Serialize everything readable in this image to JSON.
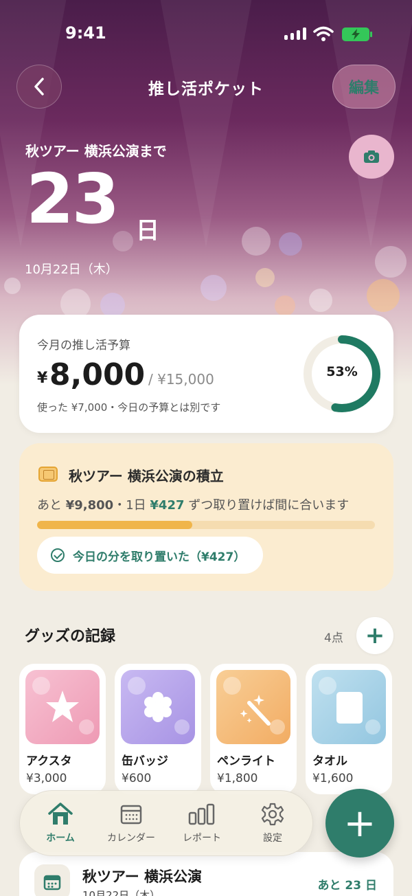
{
  "status_bar": {
    "time": "9:41"
  },
  "header": {
    "title": "推し活ポケット",
    "edit_label": "編集"
  },
  "countdown": {
    "label": "秋ツアー 横浜公演まで",
    "days": "23",
    "unit": "日",
    "date": "10月22日（木）"
  },
  "budget": {
    "title": "今月の推し活予算",
    "currency": "¥",
    "remaining": "8,000",
    "total": "/ ¥15,000",
    "note": "使った ¥7,000・今日の予算とは別です",
    "percent_label": "53%",
    "percent": 53,
    "ring_color": "#1f7a62"
  },
  "savings": {
    "title": "秋ツアー 横浜公演の積立",
    "text_prefix": "あと ",
    "remaining": "¥9,800",
    "text_mid": "・1日 ",
    "daily": "¥427",
    "text_suffix": " ずつ取り置けば間に合います",
    "progress": 0.46,
    "button_label": "今日の分を取り置いた（¥427）"
  },
  "goods": {
    "title": "グッズの記録",
    "count": "4点",
    "add_label": "+",
    "items": [
      {
        "name": "アクスタ",
        "price": "¥3,000",
        "icon": "star-icon",
        "color": "#f1a9c0"
      },
      {
        "name": "缶バッジ",
        "price": "¥600",
        "icon": "badge-icon",
        "color": "#b7a6ea"
      },
      {
        "name": "ペンライト",
        "price": "¥1,800",
        "icon": "wand-icon",
        "color": "#f6bf7f"
      },
      {
        "name": "タオル",
        "price": "¥1,600",
        "icon": "towel-icon",
        "color": "#a8d3e8"
      }
    ]
  },
  "bottom_nav": {
    "items": [
      {
        "label": "ホーム",
        "icon": "home-icon",
        "active": true
      },
      {
        "label": "カレンダー",
        "icon": "calendar-icon",
        "active": false
      },
      {
        "label": "レポート",
        "icon": "report-icon",
        "active": false
      },
      {
        "label": "設定",
        "icon": "gear-icon",
        "active": false
      }
    ],
    "fab_label": "+"
  },
  "event": {
    "title": "秋ツアー 横浜公演",
    "date": "10月22日（木）",
    "remaining": "あと 23 日"
  },
  "colors": {
    "accent": "#2f7d6b",
    "hero_top": "#4a1d4a",
    "savings_bg": "#fbecd0",
    "savings_bar": "#f0b54a"
  }
}
